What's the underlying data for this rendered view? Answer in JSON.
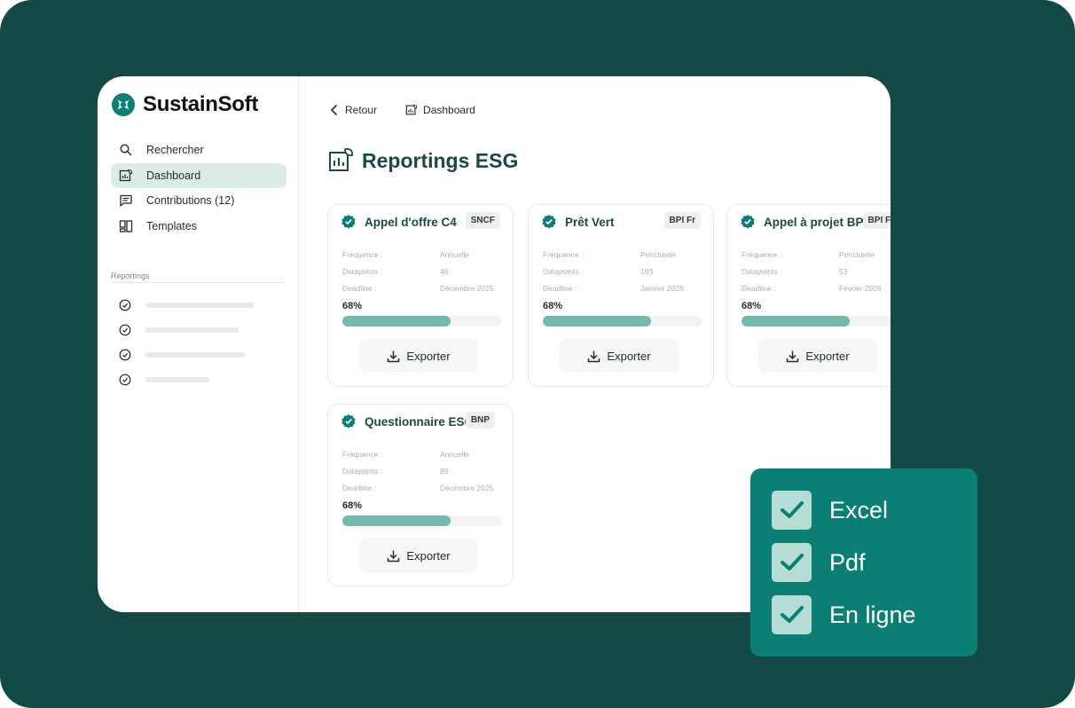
{
  "brand": {
    "name": "SustainSoft"
  },
  "sidebar": {
    "items": [
      {
        "label": "Rechercher",
        "icon": "search-icon"
      },
      {
        "label": "Dashboard",
        "icon": "dashboard-icon",
        "active": true
      },
      {
        "label": "Contributions (12)",
        "icon": "comment-icon"
      },
      {
        "label": "Templates",
        "icon": "template-icon"
      }
    ],
    "section_label": "Reportings",
    "reporting_placeholders": 4
  },
  "topbar": {
    "back_label": "Retour",
    "dashboard_label": "Dashboard"
  },
  "page": {
    "title": "Reportings ESG"
  },
  "cards": [
    {
      "title": "Appel d'offre C4",
      "badge": "SNCF",
      "frequence_label": "Fréquence :",
      "frequence": "Annuelle",
      "datapoints_label": "Datapoints :",
      "datapoints": "46",
      "deadline_label": "Deadline :",
      "deadline": "Décembre 2025",
      "progress": "68%",
      "export_label": "Exporter"
    },
    {
      "title": "Prêt Vert",
      "badge": "BPI Fr",
      "frequence_label": "Fréquence :",
      "frequence": "Ponctuelle",
      "datapoints_label": "Datapoints :",
      "datapoints": "103",
      "deadline_label": "Deadline :",
      "deadline": "Janvier 2026",
      "progress": "68%",
      "export_label": "Exporter"
    },
    {
      "title": "Appel à projet BPI",
      "badge": "BPI Fr",
      "frequence_label": "Fréquence :",
      "frequence": "Ponctuelle",
      "datapoints_label": "Datapoints :",
      "datapoints": "53",
      "deadline_label": "Deadline :",
      "deadline": "Février 2026",
      "progress": "68%",
      "export_label": "Exporter"
    },
    {
      "title": "Questionnaire ESG",
      "badge": "BNP",
      "frequence_label": "Fréquence :",
      "frequence": "Annuelle",
      "datapoints_label": "Datapoints :",
      "datapoints": "89",
      "deadline_label": "Deadline :",
      "deadline": "Décembre 2025",
      "progress": "68%",
      "export_label": "Exporter"
    }
  ],
  "export_options": [
    {
      "label": "Excel",
      "checked": true
    },
    {
      "label": "Pdf",
      "checked": true
    },
    {
      "label": "En ligne",
      "checked": true
    }
  ],
  "colors": {
    "background": "#134a45",
    "accent": "#0b7f74",
    "progress": "#74b9ad",
    "active_nav": "#dcebe4",
    "title": "#1a4a43"
  }
}
